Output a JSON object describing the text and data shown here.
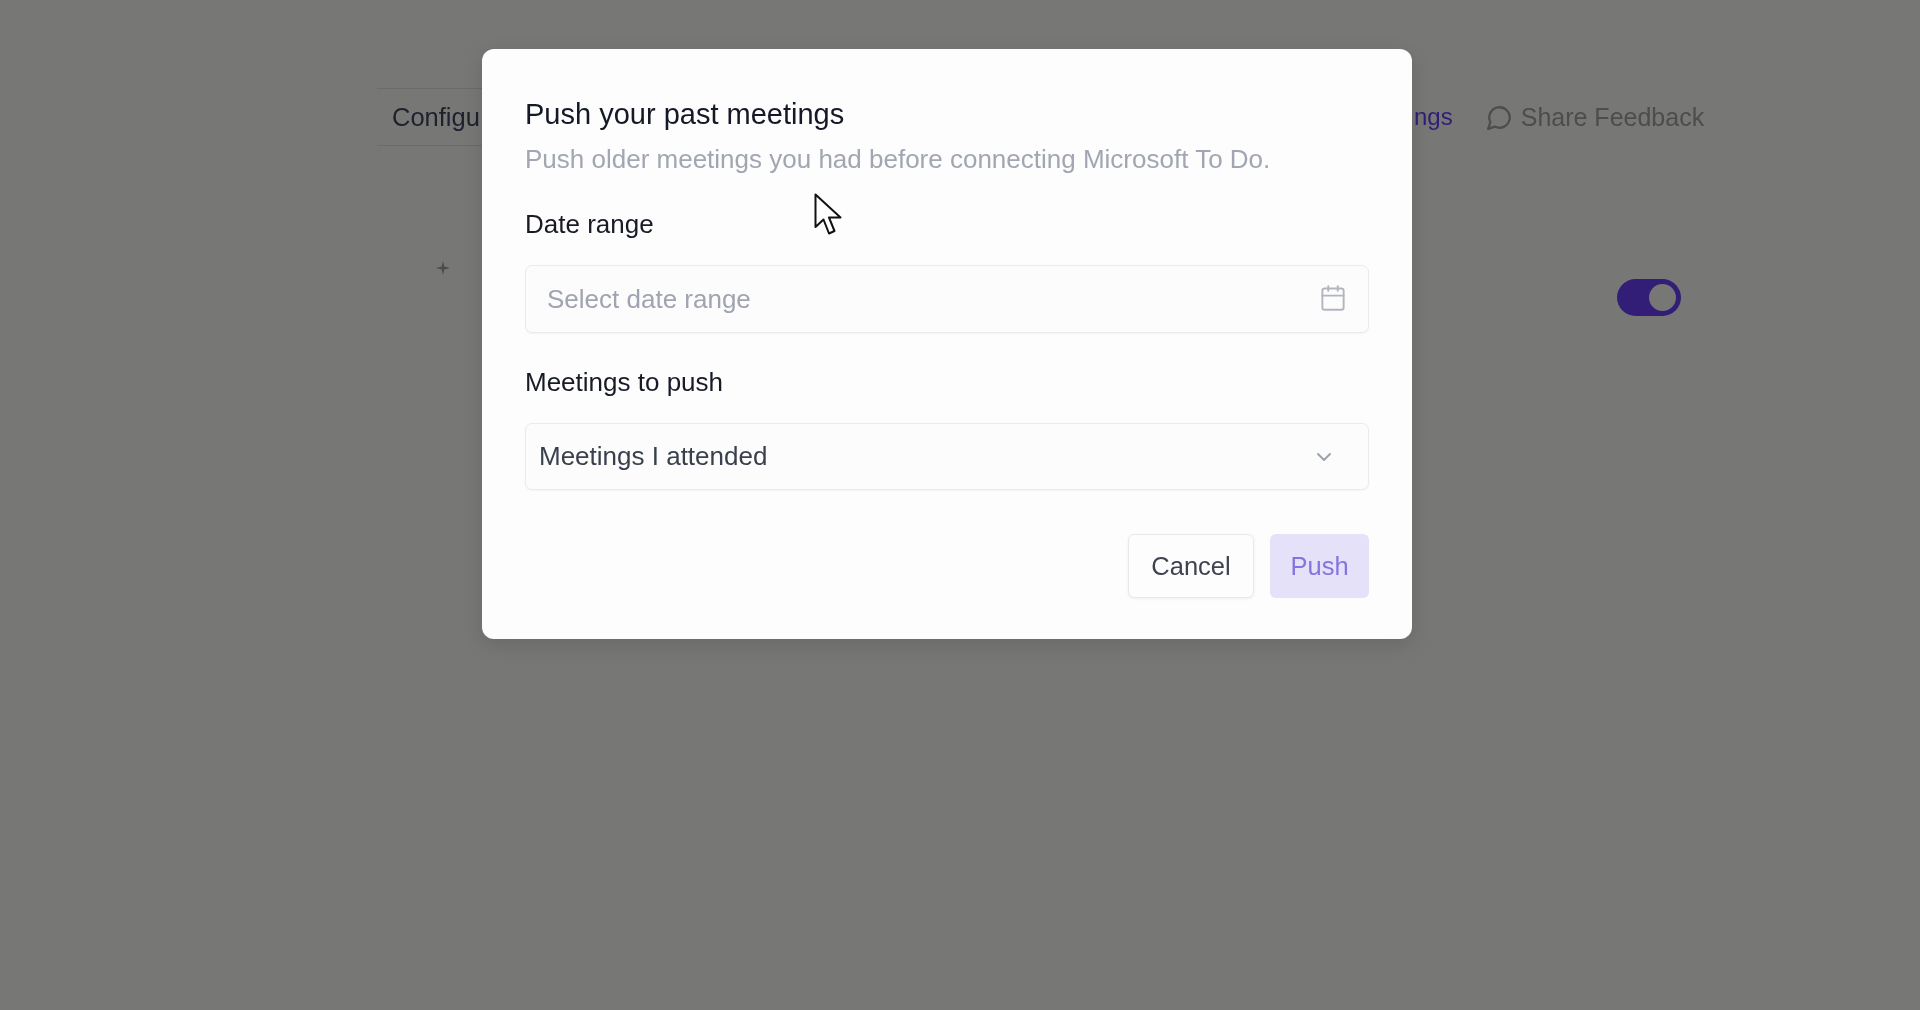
{
  "background": {
    "nav_tab": "Configu",
    "nav_link": "ngs",
    "feedback_button": "Share Feedback",
    "toggle": {
      "on": true
    }
  },
  "dialog": {
    "title": "Push your past meetings",
    "subtitle": "Push older meetings you had before connecting Microsoft To Do.",
    "fields": [
      {
        "kind": "date",
        "label": "Date range",
        "placeholder": "Select date range"
      },
      {
        "kind": "select",
        "label": "Meetings to push",
        "value": "Meetings I attended"
      }
    ],
    "buttons": [
      {
        "kind": "secondary",
        "label": "Cancel",
        "disabled": false
      },
      {
        "kind": "primary",
        "label": "Push",
        "disabled": true
      }
    ]
  }
}
